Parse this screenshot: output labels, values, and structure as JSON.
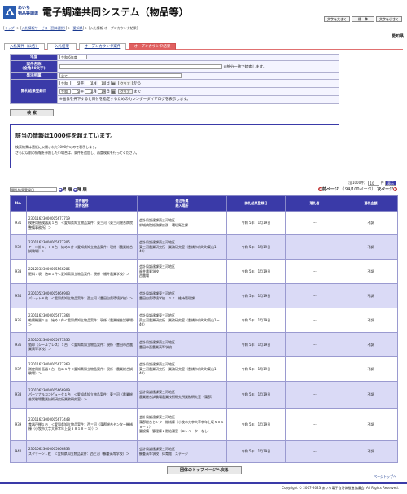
{
  "header": {
    "brand_line1": "あいち",
    "brand_line2": "物品等調達",
    "title": "電子調達共同システム（物品等）",
    "font_buttons": [
      "文字を大きく",
      "標　準",
      "文字を小さく"
    ]
  },
  "breadcrumb": {
    "top": "トップ",
    "item2": "入札情報サービス（団体選択）",
    "item3": "愛知県",
    "current": "入札情報-オープンカウンタ結果"
  },
  "organization": "愛知県",
  "tabs": [
    {
      "label": "入札案件（公告）"
    },
    {
      "label": "入札結果"
    },
    {
      "label": "オープンカウンタ案件"
    },
    {
      "label": "オープンカウンタ結果"
    }
  ],
  "form": {
    "year_label": "年度",
    "year_value": "令和 6年度",
    "case_label": "案件名称",
    "case_sub": "(全角50文字)",
    "case_note": "※部分一致で検索します。",
    "issuer_label": "発注所属",
    "issuer_value": "全て",
    "date_label": "開札結果登録日",
    "from_era": "令和",
    "from_year": "5",
    "from_month": "1",
    "from_day": "10",
    "to_era": "令和",
    "to_year": "5",
    "to_month": "1",
    "to_day": "19",
    "unit_year": "年",
    "unit_month": "月",
    "unit_day": "日",
    "clear": "クリア",
    "from_word": "から",
    "to_word": "まで",
    "cal_note": "※画像を押下すると日付を指定するためのカレンダーダイアログを表示します。",
    "search_button": "検 索"
  },
  "message": {
    "heading": "該当の情報は1000件を超えています。",
    "line1": "検索結果は直近に公開された1000件のみを表示します。",
    "line2": "さらに以前の情報を参照したい場合は、条件を追加し、再度検索を行ってください。"
  },
  "controls": {
    "count_text": "（全1000件）",
    "per_page": "10",
    "per_page_unit": "件",
    "go": "表示",
    "sort_value": "開札結果登録日",
    "asc": "昇 順",
    "desc": "降 順",
    "prev": "前ページ",
    "page_info": "（ 94/100ページ）",
    "next": "次ページ"
  },
  "table": {
    "headers": [
      "No.",
      "案件番号\n案件名称",
      "発注所属\n納入場所",
      "開札結果登録日",
      "落札者",
      "落札金額"
    ],
    "rows": [
      {
        "no": "931",
        "num": "23011623000005677719",
        "name": "検便用植検器具１台　＜愛知県知立物品案件：東三河（東三河総合病院整備事務所）＞",
        "issuer": "会計局調達課東三河地区\n新城病院総務課庶務　環境衛生課",
        "date": "令和 5年　1月19日",
        "winner": "---",
        "amount": "不調"
      },
      {
        "no": "932",
        "num": "23011623000005677305",
        "name": "Ｐ・Ｈ計１，００台　始め１件＜愛知県知立物品案件：現係（農業総合試験場）＞",
        "issuer": "会計局調達課東三河地区\n東三河農業研究所　業務研究室（豊橋市前町町東山1～40）",
        "date": "令和 5年　1月19日",
        "winner": "---",
        "amount": "不調"
      },
      {
        "no": "933",
        "num": "22122323000005566286",
        "name": "肥料７袋　始め１件＜愛知県知立物品案件：現係（福井農業学校）＞",
        "issuer": "会計局調達課東三河地区\n福井農業学校\n西農場",
        "date": "令和 5年　1月19日",
        "winner": "---",
        "amount": "不調"
      },
      {
        "no": "934",
        "num": "23010523000005666903",
        "name": "パレット６枚　＜愛知県知立物品案件：西三河（豊田自然環境学校）＞",
        "issuer": "会計局調達課東三河地区\n豊田自然環境学校　１Ｆ　維持管理課",
        "date": "令和 5年　1月19日",
        "winner": "---",
        "amount": "不調"
      },
      {
        "no": "935",
        "num": "23011623000005677364",
        "name": "乾燥機器１台　始め１件＜愛知県知立物品案件：現係（農業総合試験場）＞",
        "issuer": "会計局調達課東三河地区\n東三河農業研究所　業務研究室（豊橋市前町町東山1～40）",
        "date": "令和 5年　1月19日",
        "winner": "---",
        "amount": "不調"
      },
      {
        "no": "936",
        "num": "23010523000005677335",
        "name": "箔印（シールプレス）１台　＜愛知県知立物品案件：現係（豊田市西農業高等学校）＞",
        "issuer": "会計局調達課東三河地区\n豊田市西農業高等学校",
        "date": "令和 5年　1月19日",
        "winner": "---",
        "amount": "不調"
      },
      {
        "no": "937",
        "num": "23011623000005677363",
        "name": "測定用計画器１台　始め１件＜愛知県知立物品案件：現係（農業総合試験場）＞",
        "issuer": "会計局調達課東三河地区\n東三河農業研究所　業務研究室（豊橋市前町町東山1～40）",
        "date": "令和 5年　1月19日",
        "winner": "---",
        "amount": "不調"
      },
      {
        "no": "938",
        "num": "23010623000005666909",
        "name": "パーソナルコンピュータ１台　＜愛知県知立物品案件：東三河（農業総合試験場農業技術研究所業務研究室）＞",
        "issuer": "会計局調達課東三河地区\n農業総合試験場農業技術研究所業務研究室（蒲郡）",
        "date": "令和 5年　1月19日",
        "winner": "---",
        "amount": "不調"
      },
      {
        "no": "939",
        "num": "23011623000005677448",
        "name": "食器戸棚１台　＜愛知県知立物品案件：西三河（蒲郡総合センター機械棟（小牧市大字大草字年上坂５８１８－１））＞",
        "issuer": "会計局調達課東三河地区\n蒲郡総合センター機械棟（小牧市大字大草字年上坂５８１８－１）\n要設備　管理棟２階給湯室（エレベータ－なし）",
        "date": "令和 5年　1月19日",
        "winner": "---",
        "amount": "不調"
      },
      {
        "no": "940",
        "num": "23010623000005666833",
        "name": "スクリーン１枚　＜愛知県知立物品案件：西三河（鶴峯高等学校）＞",
        "issuer": "会計局調達課東三河地区\n鶴峯高等学校　体育館　ステージ",
        "date": "令和 5年　1月19日",
        "winner": "---",
        "amount": "不調"
      }
    ]
  },
  "bottom_button": "団体のトップページへ戻る",
  "page_top": "ページトップへ",
  "footer": "Copyright © 2007-2023 あいち電子自治体推進協議会. All Rights Reserved.",
  "colors": {
    "header_blue": "#3a3aa8",
    "active_tab": "#e06060",
    "row_alt": "#dadaf6"
  }
}
